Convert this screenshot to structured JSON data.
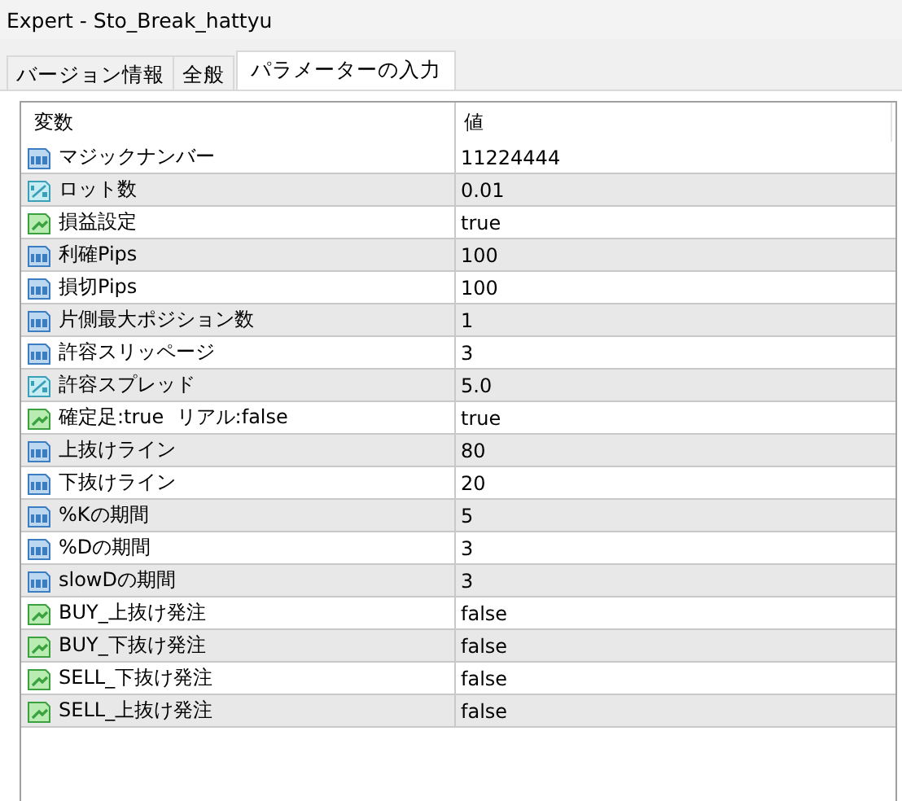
{
  "window": {
    "title": "Expert - Sto_Break_hattyu"
  },
  "tabs": [
    {
      "label": "バージョン情報",
      "selected": false
    },
    {
      "label": "全般",
      "selected": false
    },
    {
      "label": "パラメーターの入力",
      "selected": true
    }
  ],
  "table": {
    "columns": [
      "変数",
      "値"
    ],
    "rows": [
      {
        "kind": "int",
        "name": "マジックナンバー",
        "value": "11224444"
      },
      {
        "kind": "double",
        "name": "ロット数",
        "value": "0.01"
      },
      {
        "kind": "bool",
        "name": "損益設定",
        "value": "true"
      },
      {
        "kind": "int",
        "name": "利確Pips",
        "value": "100"
      },
      {
        "kind": "int",
        "name": "損切Pips",
        "value": "100"
      },
      {
        "kind": "int",
        "name": "片側最大ポジション数",
        "value": "1"
      },
      {
        "kind": "int",
        "name": "許容スリッページ",
        "value": "3"
      },
      {
        "kind": "double",
        "name": "許容スプレッド",
        "value": "5.0"
      },
      {
        "kind": "bool",
        "name": "確定足:true  リアル:false",
        "value": "true"
      },
      {
        "kind": "int",
        "name": "上抜けライン",
        "value": "80"
      },
      {
        "kind": "int",
        "name": "下抜けライン",
        "value": "20"
      },
      {
        "kind": "int",
        "name": "%Kの期間",
        "value": "5"
      },
      {
        "kind": "int",
        "name": "%Dの期間",
        "value": "3"
      },
      {
        "kind": "int",
        "name": "slowDの期間",
        "value": "3"
      },
      {
        "kind": "bool",
        "name": "BUY_上抜け発注",
        "value": "false"
      },
      {
        "kind": "bool",
        "name": "BUY_下抜け発注",
        "value": "false"
      },
      {
        "kind": "bool",
        "name": "SELL_下抜け発注",
        "value": "false"
      },
      {
        "kind": "bool",
        "name": "SELL_上抜け発注",
        "value": "false"
      }
    ]
  }
}
